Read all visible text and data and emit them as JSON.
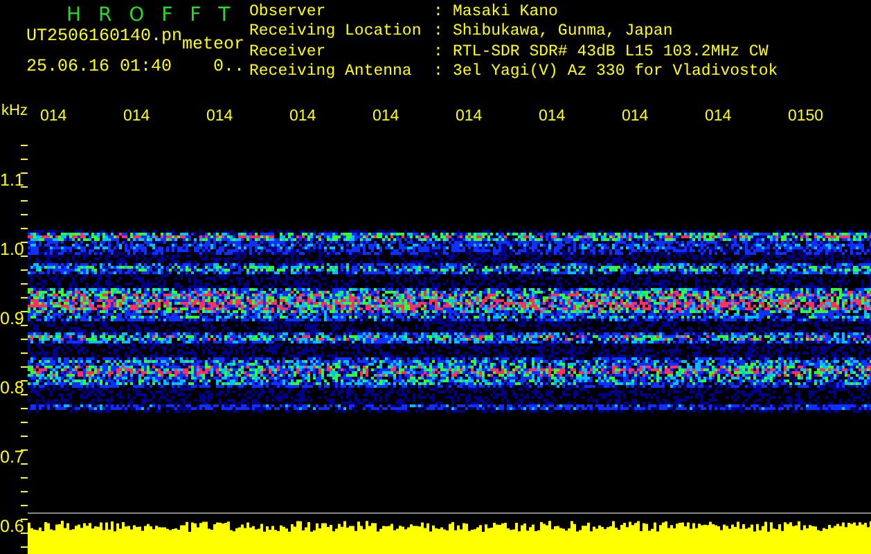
{
  "header": {
    "title": "H R O F F T",
    "filename": "UT2506160140.pn",
    "tag": "meteor",
    "datetime": "25.06.16 01:40",
    "counter": "0..",
    "info": [
      {
        "label": "Observer",
        "separator": ":",
        "value": "Masaki Kano"
      },
      {
        "label": "Receiving Location",
        "separator": ":",
        "value": "Shibukawa, Gunma, Japan"
      },
      {
        "label": "Receiver",
        "separator": ":",
        "value": "RTL-SDR SDR# 43dB L15 103.2MHz CW"
      },
      {
        "label": "Receiving Antenna",
        "separator": ":",
        "value": "3el Yagi(V) Az 330 for Vladivostok"
      }
    ]
  },
  "plot": {
    "unit": "kHz",
    "x_ticks": [
      "014",
      "014",
      "014",
      "014",
      "014",
      "014",
      "014",
      "014",
      "014",
      "0150"
    ],
    "y_ticks": [
      "1.1",
      "1.0",
      "0.9",
      "0.8",
      "0.7",
      "0.6"
    ]
  }
}
